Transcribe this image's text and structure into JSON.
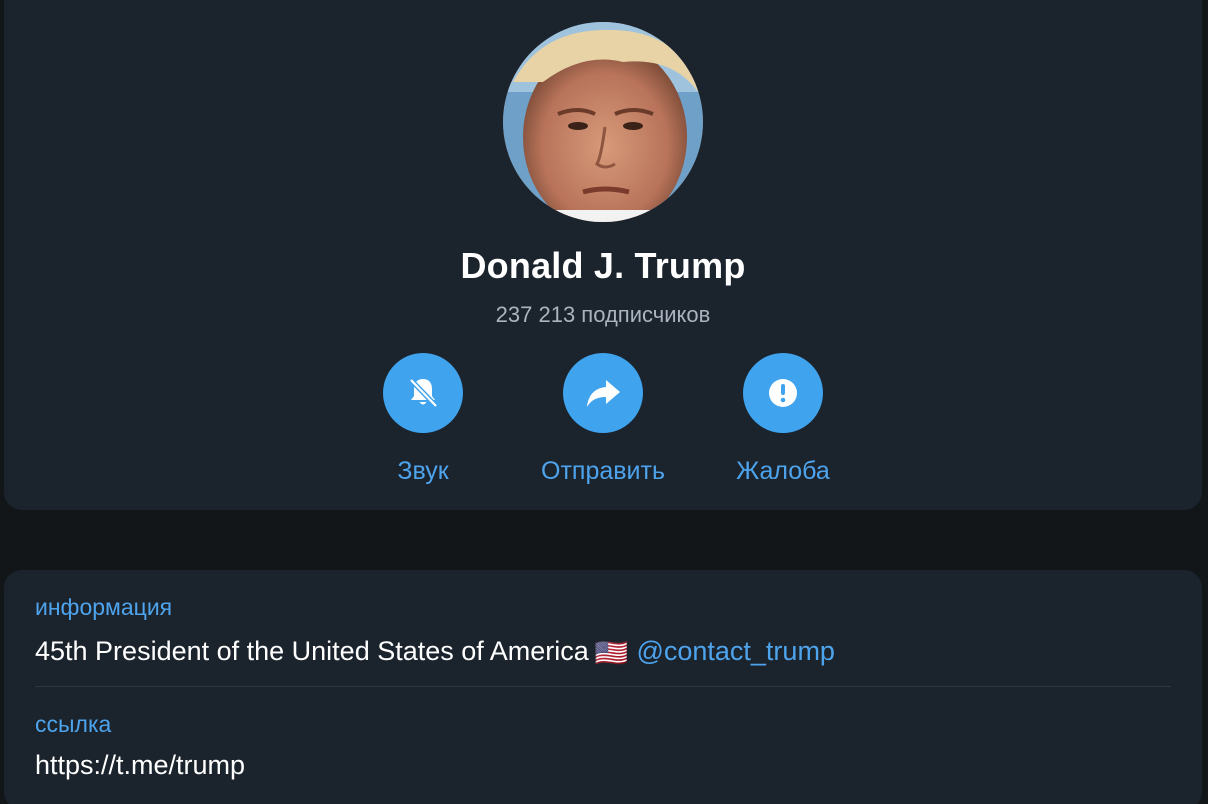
{
  "profile": {
    "name": "Donald J. Trump",
    "subscribers": "237 213 подписчиков"
  },
  "actions": [
    {
      "label": "Звук",
      "icon": "bell-muted-icon"
    },
    {
      "label": "Отправить",
      "icon": "share-arrow-icon"
    },
    {
      "label": "Жалоба",
      "icon": "exclamation-icon"
    }
  ],
  "info": {
    "label": "информация",
    "text": "45th President of the United States of America",
    "flag": "🇺🇸",
    "mention": "@contact_trump"
  },
  "link": {
    "label": "ссылка",
    "url": "https://t.me/trump"
  },
  "colors": {
    "accent": "#3fa3ee",
    "card": "#1b232d",
    "background": "#131619"
  }
}
